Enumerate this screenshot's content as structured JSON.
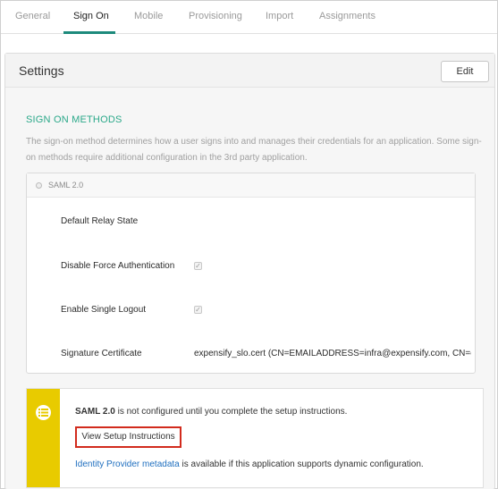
{
  "tabs": [
    {
      "label": "General"
    },
    {
      "label": "Sign On"
    },
    {
      "label": "Mobile"
    },
    {
      "label": "Provisioning"
    },
    {
      "label": "Import"
    },
    {
      "label": "Assignments"
    }
  ],
  "active_tab": "Sign On",
  "settings": {
    "title": "Settings",
    "edit_label": "Edit"
  },
  "sign_on_methods": {
    "title": "SIGN ON METHODS",
    "description": "The sign-on method determines how a user signs into and manages their credentials for an application. Some sign-on methods require additional configuration in the 3rd party application."
  },
  "saml": {
    "header": "SAML 2.0",
    "rows": [
      {
        "label": "Default Relay State",
        "value": ""
      },
      {
        "label": "Disable Force Authentication",
        "checked": true
      },
      {
        "label": "Enable Single Logout",
        "checked": true
      },
      {
        "label": "Signature Certificate",
        "value": "expensify_slo.cert (CN=EMAILADDRESS=infra@expensify.com, CN=e"
      }
    ]
  },
  "notice": {
    "strong": "SAML 2.0",
    "text": " is not configured until you complete the setup instructions.",
    "button_label": "View Setup Instructions",
    "link_text": "Identity Provider metadata",
    "link_suffix": " is available if this application supports dynamic configuration."
  },
  "colors": {
    "accent": "#1d8a7c",
    "section_title": "#2aa889",
    "notice_stripe": "#e8cb00",
    "highlight_border": "#d22b1d",
    "link": "#1f6fbf"
  },
  "icons": {
    "notice": "list-icon",
    "checkbox": "checkmark-icon"
  }
}
